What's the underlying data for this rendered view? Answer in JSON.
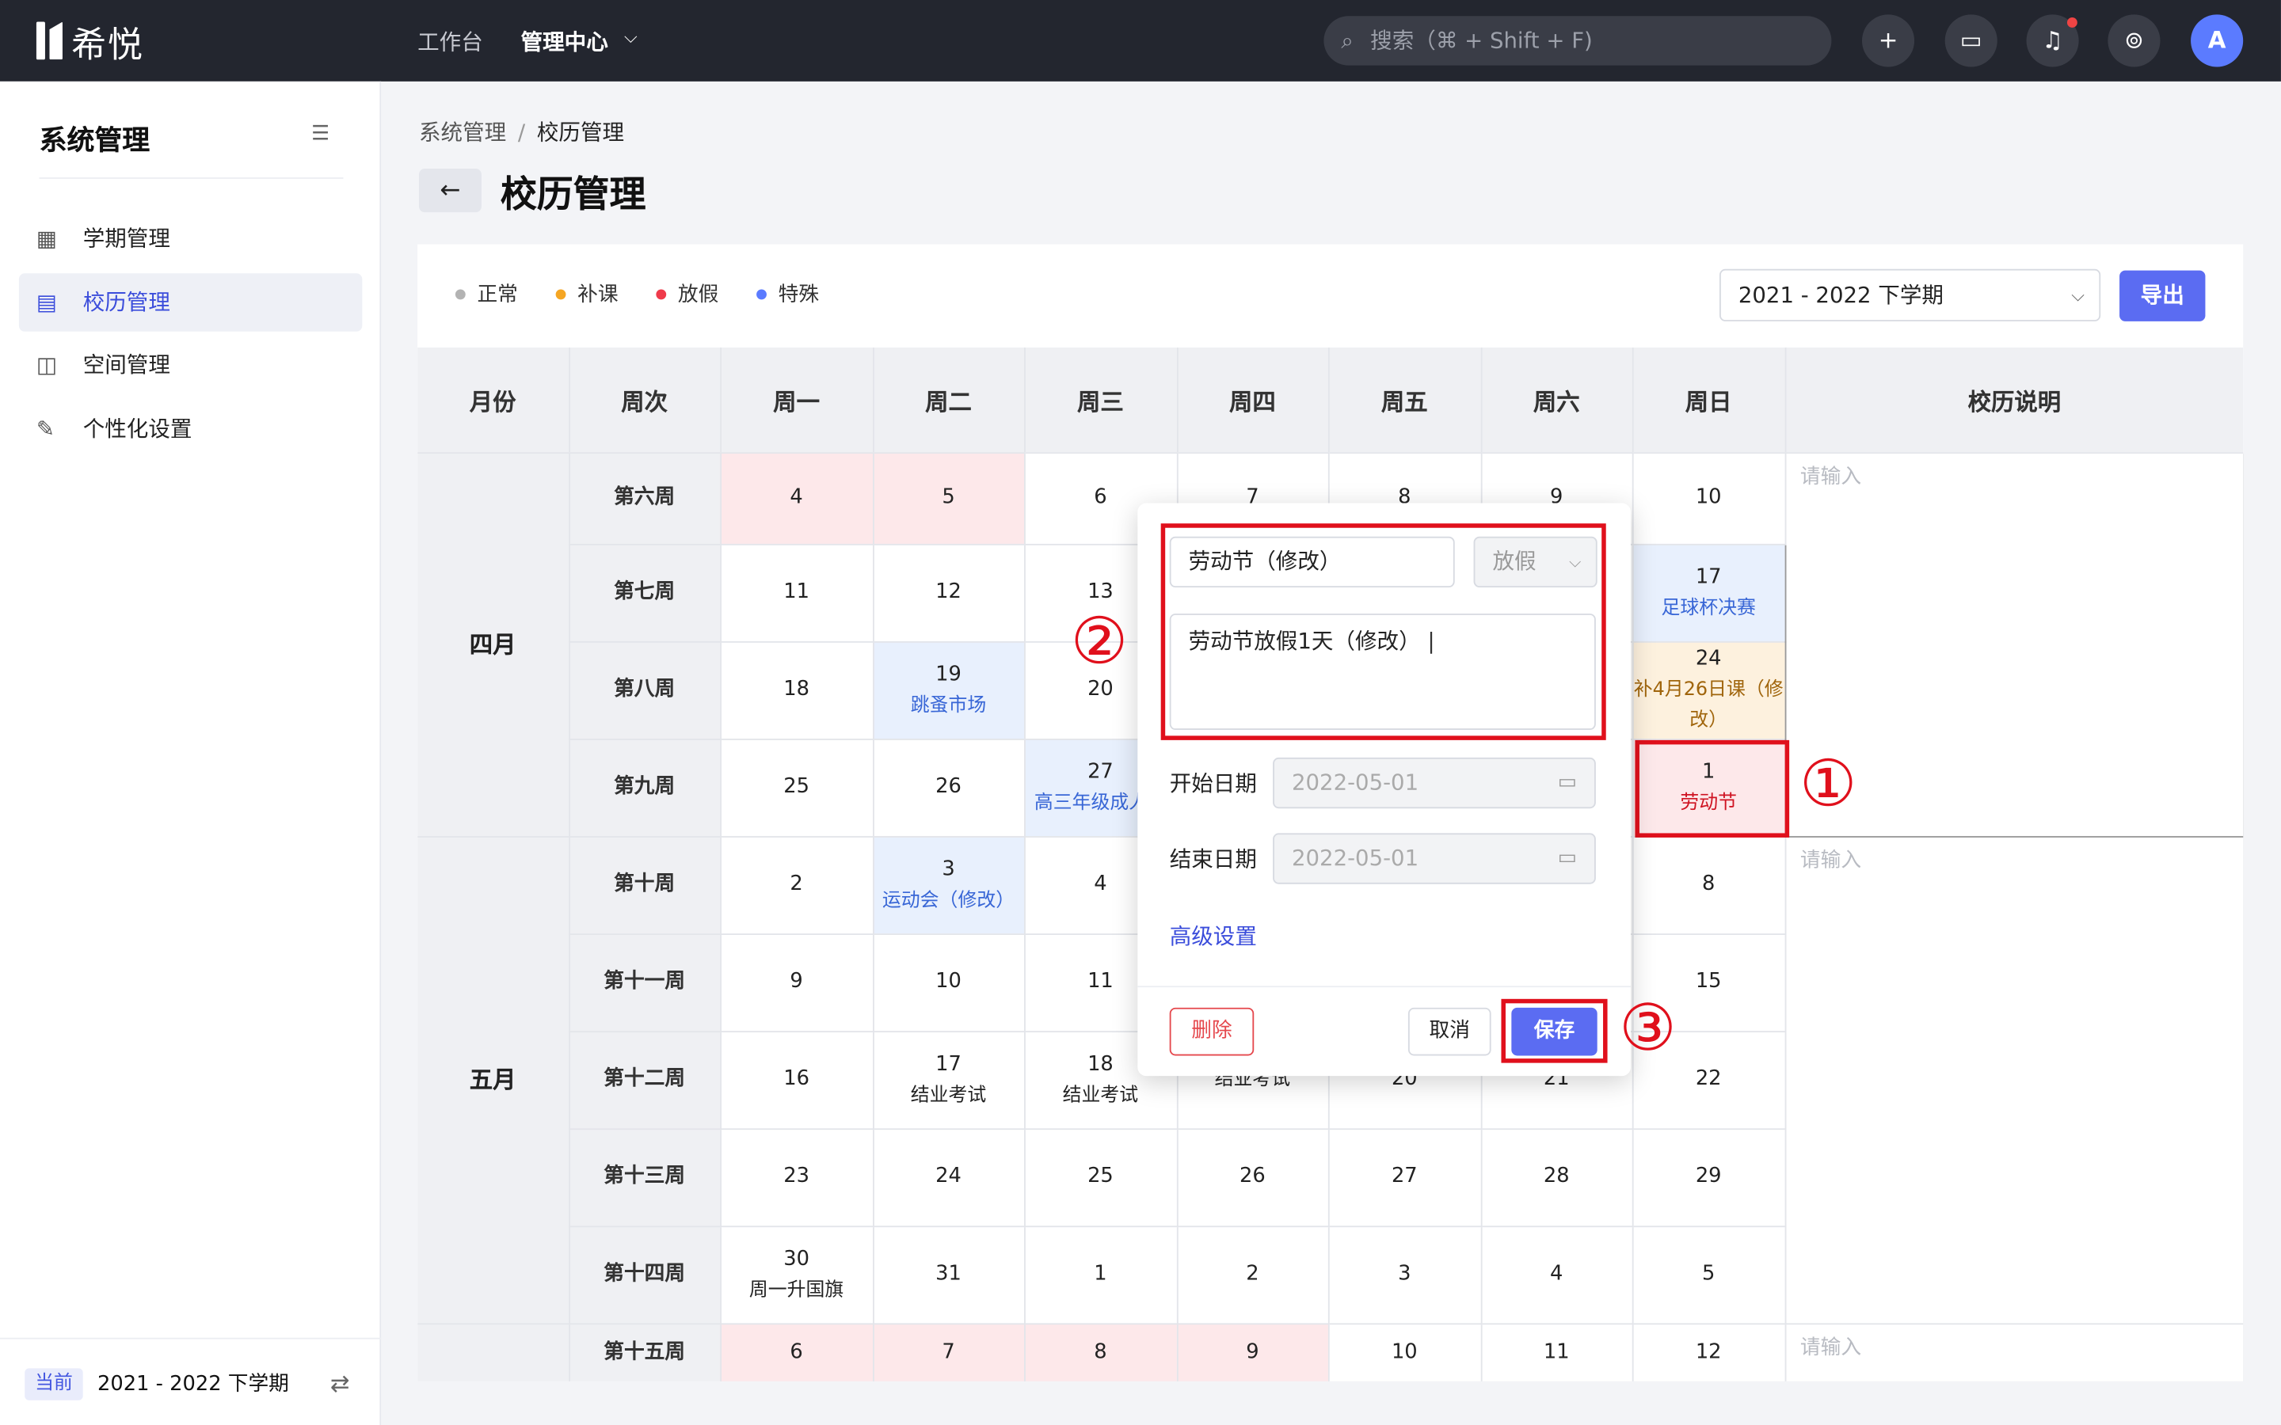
{
  "app": {
    "logo_text": "希悦"
  },
  "topbar": {
    "nav": [
      "工作台",
      "管理中心"
    ],
    "search_placeholder": "搜索（⌘ + Shift + F)",
    "avatar": "A"
  },
  "sidebar": {
    "title": "系统管理",
    "items": [
      {
        "label": "学期管理",
        "icon": "calendar-icon"
      },
      {
        "label": "校历管理",
        "icon": "grid-calendar-icon"
      },
      {
        "label": "空间管理",
        "icon": "cube-icon"
      },
      {
        "label": "个性化设置",
        "icon": "tools-icon"
      }
    ],
    "footer": {
      "badge": "当前",
      "term": "2021 - 2022 下学期"
    }
  },
  "breadcrumb": {
    "parent": "系统管理",
    "separator": "/",
    "current": "校历管理"
  },
  "page_title": "校历管理",
  "legend": [
    {
      "label": "正常",
      "color": "#b3b3b3"
    },
    {
      "label": "补课",
      "color": "#f5a623"
    },
    {
      "label": "放假",
      "color": "#ef3b4b"
    },
    {
      "label": "特殊",
      "color": "#5b7bff"
    }
  ],
  "term_select": "2021 - 2022 下学期",
  "export_label": "导出",
  "table": {
    "headers": [
      "月份",
      "周次",
      "周一",
      "周二",
      "周三",
      "周四",
      "周五",
      "周六",
      "周日",
      "校历说明"
    ],
    "months": [
      "四月",
      "五月"
    ],
    "weeks": [
      "第六周",
      "第七周",
      "第八周",
      "第九周",
      "第十周",
      "第十一周",
      "第十二周",
      "第十三周",
      "第十四周",
      "第十五周"
    ],
    "note_placeholder": "请输入",
    "rows": [
      [
        {
          "d": "4"
        },
        {
          "d": "5"
        },
        {
          "d": "6"
        },
        {
          "d": "7"
        },
        {
          "d": "8"
        },
        {
          "d": "9"
        },
        {
          "d": "10"
        }
      ],
      [
        {
          "d": "11"
        },
        {
          "d": "12"
        },
        {
          "d": "13"
        },
        {
          "d": ""
        },
        {
          "d": ""
        },
        {
          "d": ""
        },
        {
          "d": "17",
          "e": "足球杯决赛"
        }
      ],
      [
        {
          "d": "18"
        },
        {
          "d": "19",
          "e": "跳蚤市场"
        },
        {
          "d": "20"
        },
        {
          "d": ""
        },
        {
          "d": ""
        },
        {
          "d": ""
        },
        {
          "d": "24",
          "e": "补4月26日课（修改）"
        }
      ],
      [
        {
          "d": "25"
        },
        {
          "d": "26"
        },
        {
          "d": "27",
          "e": "高三年级成人礼"
        },
        {
          "d": ""
        },
        {
          "d": ""
        },
        {
          "d": ""
        },
        {
          "d": "1",
          "e": "劳动节"
        }
      ],
      [
        {
          "d": "2"
        },
        {
          "d": "3",
          "e": "运动会（修改）"
        },
        {
          "d": "4"
        },
        {
          "d": ""
        },
        {
          "d": ""
        },
        {
          "d": ""
        },
        {
          "d": "8"
        }
      ],
      [
        {
          "d": "9"
        },
        {
          "d": "10"
        },
        {
          "d": "11"
        },
        {
          "d": ""
        },
        {
          "d": ""
        },
        {
          "d": ""
        },
        {
          "d": "15"
        }
      ],
      [
        {
          "d": "16"
        },
        {
          "d": "17",
          "e": "结业考试"
        },
        {
          "d": "18",
          "e": "结业考试"
        },
        {
          "d": "",
          "e": "结业考试"
        },
        {
          "d": "20"
        },
        {
          "d": "21"
        },
        {
          "d": "22"
        }
      ],
      [
        {
          "d": "23"
        },
        {
          "d": "24"
        },
        {
          "d": "25"
        },
        {
          "d": "26"
        },
        {
          "d": "27"
        },
        {
          "d": "28"
        },
        {
          "d": "29"
        }
      ],
      [
        {
          "d": "30",
          "e": "周一升国旗"
        },
        {
          "d": "31"
        },
        {
          "d": "1"
        },
        {
          "d": "2"
        },
        {
          "d": "3"
        },
        {
          "d": "4"
        },
        {
          "d": "5"
        }
      ],
      [
        {
          "d": "6"
        },
        {
          "d": "7"
        },
        {
          "d": "8"
        },
        {
          "d": "9"
        },
        {
          "d": "10"
        },
        {
          "d": "11"
        },
        {
          "d": "12"
        }
      ]
    ]
  },
  "popup": {
    "name_value": "劳动节（修改）",
    "type_value": "放假",
    "desc_value": "劳动节放假1天（修改）",
    "start_label": "开始日期",
    "start_value": "2022-05-01",
    "end_label": "结束日期",
    "end_value": "2022-05-01",
    "advanced": "高级设置",
    "delete": "删除",
    "cancel": "取消",
    "save": "保存"
  },
  "callouts": [
    "①",
    "②",
    "③"
  ],
  "colors": {
    "accent": "#5b6cf2",
    "holiday_bg": "#fde8ea",
    "special_bg": "#e8f0fd",
    "makeup_bg": "#fdf1de",
    "callout": "#e0101c"
  }
}
